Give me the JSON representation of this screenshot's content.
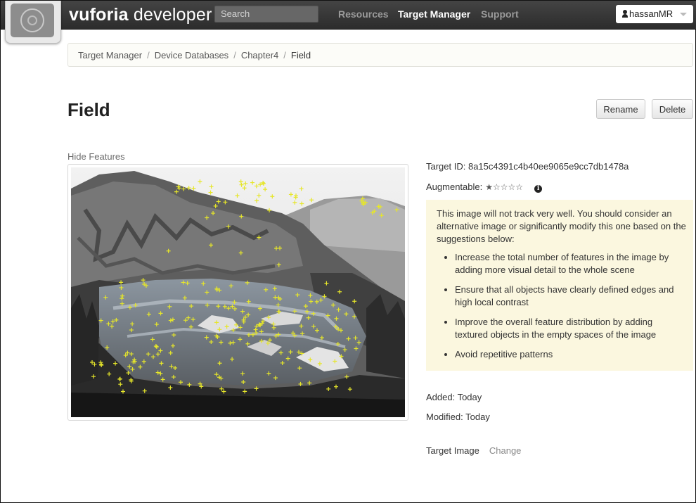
{
  "header": {
    "brand_bold": "vuforia",
    "brand_rest": " developer",
    "search_placeholder": "Search",
    "nav": [
      "Resources",
      "Target Manager",
      "Support"
    ],
    "user": "hassanMR"
  },
  "breadcrumb": [
    "Target Manager",
    "Device Databases",
    "Chapter4",
    "Field"
  ],
  "page": {
    "title": "Field",
    "rename_label": "Rename",
    "delete_label": "Delete"
  },
  "image_panel": {
    "hide_features": "Hide Features"
  },
  "details": {
    "target_id": "Target ID: 8a15c4391c4b40ee9065e9cc7db1478a",
    "augmentable_label": "Augmentable:",
    "augmentable_rating": 1,
    "augmentable_max": 5,
    "warning_text": "This image will not track very well. You should consider an alternative image or significantly modify this one based on the suggestions below:",
    "suggestions": [
      "Increase the total number of features in the image by adding more visual detail to the whole scene",
      "Ensure that all objects have clearly defined edges and high local contrast",
      "Improve the overall feature distribution by adding textured objects in the empty spaces of the image",
      "Avoid repetitive patterns"
    ],
    "added": "Added: Today",
    "modified": "Modified: Today",
    "target_image_label": "Target Image",
    "change_label": "Change"
  },
  "colors": {
    "topbar": "#2f2f2f",
    "feature_marker": "#e6e62a",
    "warning_bg": "#fbf7df"
  }
}
